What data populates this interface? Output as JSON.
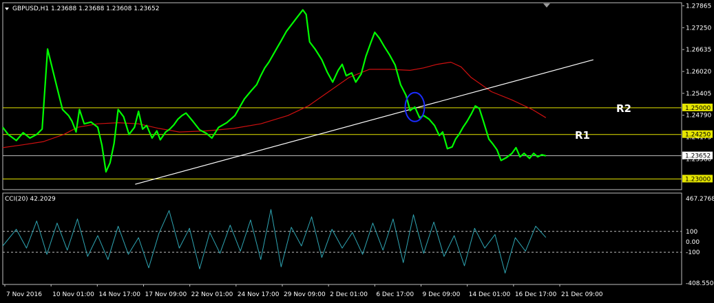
{
  "header": {
    "symbol": "GBPUSD,H1",
    "ohlc": "1.23688 1.23688 1.23608 1.23652"
  },
  "indicator": {
    "label": "CCI(20) 42.2029"
  },
  "colors": {
    "background": "#000000",
    "price": "#00ff00",
    "ma": "#d01010",
    "trendline": "#ffffff",
    "level": "#e6e600",
    "cci": "#2fa6b4",
    "circle": "#1a2cff",
    "frame": "#c0c0c0"
  },
  "chart_data": [
    {
      "type": "line",
      "pane": "price",
      "ylim": [
        1.227,
        1.2795
      ],
      "price_axis_ticks": [
        "1.27865",
        "1.27250",
        "1.26635",
        "1.26020",
        "1.25405",
        "1.24790",
        "1.24175",
        "1.23560"
      ],
      "x_ticks": [
        "7 Nov 2016",
        "10 Nov 01:00",
        "14 Nov 17:00",
        "17 Nov 09:00",
        "22 Nov 01:00",
        "24 Nov 17:00",
        "29 Nov 09:00",
        "2 Dec 01:00",
        "6 Dec 17:00",
        "9 Dec 09:00",
        "14 Dec 01:00",
        "16 Dec 17:00",
        "21 Dec 09:00"
      ],
      "series": [
        {
          "role": "price",
          "x": [
            0,
            0.008,
            0.015,
            0.02,
            0.03,
            0.04,
            0.05,
            0.058,
            0.066,
            0.078,
            0.088,
            0.097,
            0.102,
            0.108,
            0.113,
            0.12,
            0.13,
            0.14,
            0.146,
            0.152,
            0.158,
            0.164,
            0.17,
            0.178,
            0.186,
            0.194,
            0.2,
            0.206,
            0.212,
            0.22,
            0.227,
            0.232,
            0.24,
            0.246,
            0.252,
            0.258,
            0.264,
            0.27,
            0.28,
            0.29,
            0.3,
            0.308,
            0.318,
            0.33,
            0.342,
            0.356,
            0.366,
            0.374,
            0.38,
            0.386,
            0.392,
            0.398,
            0.404,
            0.41,
            0.418,
            0.426,
            0.434,
            0.442,
            0.447,
            0.452,
            0.46,
            0.47,
            0.478,
            0.486,
            0.494,
            0.5,
            0.506,
            0.514,
            0.52,
            0.528,
            0.535,
            0.542,
            0.548,
            0.555,
            0.562,
            0.57,
            0.578,
            0.586,
            0.594,
            0.6,
            0.607,
            0.614,
            0.62,
            0.628,
            0.636,
            0.643,
            0.648,
            0.655,
            0.662,
            0.667,
            0.672,
            0.678,
            0.684,
            0.69,
            0.696,
            0.702,
            0.708,
            0.716,
            0.722,
            0.728,
            0.734,
            0.742,
            0.75,
            0.756,
            0.762,
            0.768,
            0.776,
            0.782,
            0.788,
            0.794,
            0.8
          ],
          "values": [
            1.2445,
            1.2425,
            1.2415,
            1.2408,
            1.243,
            1.2415,
            1.2425,
            1.244,
            1.2665,
            1.2572,
            1.2495,
            1.2478,
            1.2462,
            1.2432,
            1.2495,
            1.2455,
            1.246,
            1.2445,
            1.2395,
            1.232,
            1.2345,
            1.24,
            1.2495,
            1.2475,
            1.2425,
            1.2445,
            1.249,
            1.244,
            1.245,
            1.2415,
            1.2435,
            1.241,
            1.2432,
            1.244,
            1.2452,
            1.2468,
            1.2478,
            1.2485,
            1.2462,
            1.2438,
            1.2428,
            1.2415,
            1.2445,
            1.2458,
            1.2478,
            1.2525,
            1.2548,
            1.2565,
            1.259,
            1.2612,
            1.2628,
            1.2648,
            1.2668,
            1.2688,
            1.2715,
            1.2735,
            1.2755,
            1.2775,
            1.2762,
            1.2685,
            1.2665,
            1.2635,
            1.26,
            1.2572,
            1.2605,
            1.2622,
            1.259,
            1.2598,
            1.2572,
            1.2595,
            1.2645,
            1.2682,
            1.2712,
            1.2695,
            1.2672,
            1.2648,
            1.262,
            1.2565,
            1.2535,
            1.2492,
            1.2502,
            1.2472,
            1.2478,
            1.2468,
            1.245,
            1.2422,
            1.2432,
            1.2385,
            1.239,
            1.2412,
            1.2425,
            1.2445,
            1.2462,
            1.2482,
            1.2505,
            1.2498,
            1.2462,
            1.2412,
            1.2398,
            1.2382,
            1.2352,
            1.236,
            1.2372,
            1.2388,
            1.2362,
            1.2372,
            1.2358,
            1.2372,
            1.2362,
            1.2368,
            1.2365
          ]
        },
        {
          "role": "moving-average",
          "x": [
            0,
            0.03,
            0.06,
            0.09,
            0.11,
            0.14,
            0.17,
            0.2,
            0.23,
            0.26,
            0.3,
            0.34,
            0.38,
            0.42,
            0.45,
            0.48,
            0.51,
            0.54,
            0.57,
            0.6,
            0.62,
            0.64,
            0.66,
            0.675,
            0.69,
            0.72,
            0.75,
            0.78,
            0.8
          ],
          "values": [
            1.2388,
            1.2396,
            1.2405,
            1.2425,
            1.2445,
            1.2455,
            1.2458,
            1.2455,
            1.2442,
            1.2432,
            1.2435,
            1.2442,
            1.2455,
            1.2478,
            1.2505,
            1.2545,
            1.2585,
            1.2608,
            1.2608,
            1.2605,
            1.2612,
            1.2622,
            1.2628,
            1.2615,
            1.2585,
            1.2545,
            1.2522,
            1.2495,
            1.2472
          ]
        },
        {
          "role": "trendline",
          "x": [
            0.195,
            0.87
          ],
          "values": [
            1.2285,
            1.2635
          ]
        }
      ],
      "horizontal_levels": [
        {
          "price_label": "1.25000",
          "value": 1.25,
          "highlighted": true
        },
        {
          "price_label": "1.24250",
          "value": 1.2425,
          "highlighted": true
        },
        {
          "price_label": "1.23652",
          "value": 1.23652,
          "highlighted": false
        },
        {
          "price_label": "1.23000",
          "value": 1.23,
          "highlighted": true
        }
      ],
      "annotations": [
        "R2",
        "R1"
      ]
    },
    {
      "type": "line",
      "pane": "indicator",
      "ylim": [
        -408.5,
        467.3
      ],
      "axis_ticks": [
        "467.2768",
        "100",
        "0.00",
        "-100",
        "-408.5508"
      ],
      "reference_levels": [
        100,
        -100
      ],
      "series": [
        {
          "role": "cci",
          "x": [
            0,
            0.02,
            0.035,
            0.05,
            0.065,
            0.08,
            0.095,
            0.11,
            0.125,
            0.14,
            0.155,
            0.17,
            0.185,
            0.2,
            0.215,
            0.23,
            0.245,
            0.26,
            0.275,
            0.29,
            0.305,
            0.32,
            0.335,
            0.35,
            0.365,
            0.38,
            0.395,
            0.41,
            0.425,
            0.44,
            0.455,
            0.47,
            0.485,
            0.5,
            0.515,
            0.53,
            0.545,
            0.56,
            0.575,
            0.59,
            0.605,
            0.62,
            0.635,
            0.65,
            0.665,
            0.68,
            0.695,
            0.71,
            0.725,
            0.74,
            0.755,
            0.77,
            0.785,
            0.8
          ],
          "values": [
            -40,
            120,
            -60,
            200,
            -120,
            180,
            -80,
            220,
            -140,
            60,
            -170,
            150,
            -120,
            40,
            -250,
            80,
            300,
            -60,
            130,
            -260,
            90,
            -110,
            160,
            -90,
            210,
            -170,
            310,
            -240,
            140,
            -40,
            240,
            -150,
            120,
            -60,
            90,
            -120,
            180,
            -80,
            220,
            -200,
            260,
            -110,
            190,
            -140,
            60,
            -230,
            130,
            -60,
            70,
            -300,
            40,
            -90,
            150,
            42
          ]
        }
      ]
    }
  ]
}
